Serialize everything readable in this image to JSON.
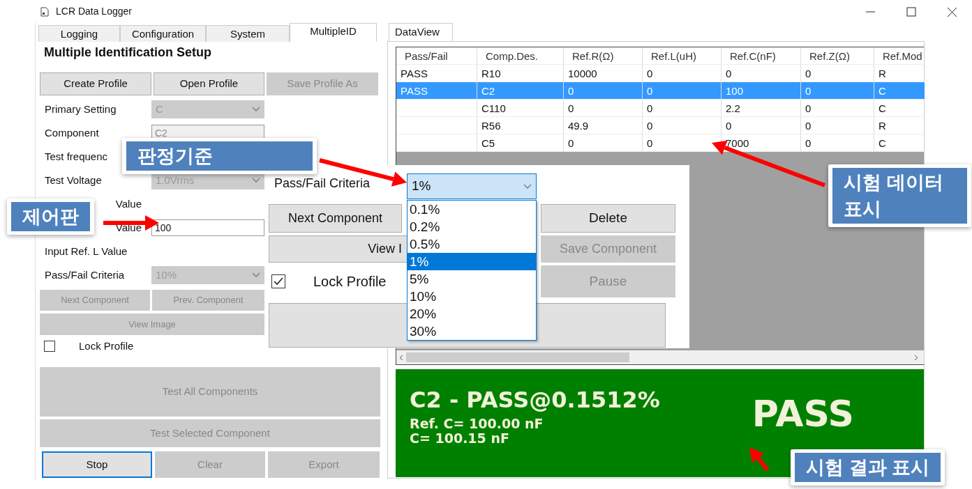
{
  "window": {
    "title": "LCR Data Logger"
  },
  "left_panel": {
    "tabs": [
      {
        "label": "Logging",
        "selected": false
      },
      {
        "label": "Configuration",
        "selected": false
      },
      {
        "label": "System",
        "selected": false
      },
      {
        "label": "MultipleID",
        "selected": true
      }
    ],
    "heading": "Multiple Identification  Setup",
    "profile_buttons": [
      {
        "label": "Create Profile",
        "disabled": false
      },
      {
        "label": "Open Profile",
        "disabled": false
      },
      {
        "label": "Save Profile As",
        "disabled": true
      }
    ],
    "form_rows": [
      {
        "kind": "select",
        "label": "Primary Setting",
        "value": "C",
        "disabled": true
      },
      {
        "kind": "input",
        "label": "Component",
        "value": "C2",
        "disabled": true
      },
      {
        "kind": "none",
        "label": "Test frequenc"
      },
      {
        "kind": "select",
        "label": "Test Voltage",
        "value": "1.0Vrms",
        "disabled": true
      },
      {
        "kind": "none",
        "label": "Value"
      },
      {
        "kind": "input",
        "label": "Value",
        "value": "100",
        "disabled": false
      },
      {
        "kind": "none",
        "label": "Input Ref. L Value"
      },
      {
        "kind": "select",
        "label": "Pass/Fail Criteria",
        "value": "10%",
        "disabled": true
      }
    ],
    "nav_buttons": [
      {
        "label": "Next Component",
        "disabled": true
      },
      {
        "label": "Prev. Component",
        "disabled": true
      }
    ],
    "view_image": {
      "label": "View Image",
      "disabled": true
    },
    "lock_profile": {
      "label": "Lock Profile",
      "checked": false
    },
    "test_buttons": [
      {
        "label": "Test All Components",
        "disabled": true
      },
      {
        "label": "Test Selected Component",
        "disabled": true
      }
    ],
    "bottom_buttons": [
      {
        "label": "Stop",
        "disabled": false,
        "focused": true
      },
      {
        "label": "Clear",
        "disabled": true,
        "focused": false
      },
      {
        "label": "Export",
        "disabled": true,
        "focused": false
      }
    ]
  },
  "data_view": {
    "tab": "DataView",
    "table": {
      "columns": [
        "Pass/Fail",
        "Comp.Des.",
        "Ref.R(Ω)",
        "Ref.L(uH)",
        "Ref.C(nF)",
        "Ref.Z(Ω)",
        "Ref.Mod"
      ],
      "rows": [
        {
          "cells": [
            "PASS",
            "R10",
            "10000",
            "0",
            "0",
            "0",
            "R"
          ],
          "selected": false
        },
        {
          "cells": [
            "PASS",
            "C2",
            "0",
            "0",
            "100",
            "0",
            "C"
          ],
          "selected": true
        },
        {
          "cells": [
            "",
            "C110",
            "0",
            "0",
            "2.2",
            "0",
            "C"
          ],
          "selected": false
        },
        {
          "cells": [
            "",
            "R56",
            "49.9",
            "0",
            "0",
            "0",
            "R"
          ],
          "selected": false
        },
        {
          "cells": [
            "",
            "C5",
            "0",
            "0",
            "7000",
            "0",
            "C"
          ],
          "selected": false
        }
      ]
    },
    "result": {
      "headline": "C2 - PASS@0.1512%",
      "reference": "Ref. C= 100.00 nF",
      "measured": "C= 100.15 nF",
      "verdict": "PASS"
    }
  },
  "inset": {
    "criteria_label": "Pass/Fail Criteria",
    "criteria_value": "1%",
    "options": [
      {
        "label": "0.1%",
        "selected": false
      },
      {
        "label": "0.2%",
        "selected": false
      },
      {
        "label": "0.5%",
        "selected": false
      },
      {
        "label": "1%",
        "selected": true
      },
      {
        "label": "5%",
        "selected": false
      },
      {
        "label": "10%",
        "selected": false
      },
      {
        "label": "20%",
        "selected": false
      },
      {
        "label": "30%",
        "selected": false
      }
    ],
    "next_button": {
      "label": "Next Component",
      "disabled": false
    },
    "delete_button": {
      "label": "Delete",
      "disabled": false
    },
    "view_button": {
      "label": "View I",
      "disabled": false
    },
    "save_button": {
      "label": "Save Component",
      "disabled": true
    },
    "lock_profile": {
      "label": "Lock Profile",
      "checked": true
    },
    "pause_button": {
      "label": "Pause",
      "disabled": true
    }
  },
  "callouts": [
    {
      "text": "판정기준"
    },
    {
      "text": "제어판"
    },
    {
      "text": "시험 데이터 표시"
    },
    {
      "text": "시험 결과 표시"
    }
  ]
}
